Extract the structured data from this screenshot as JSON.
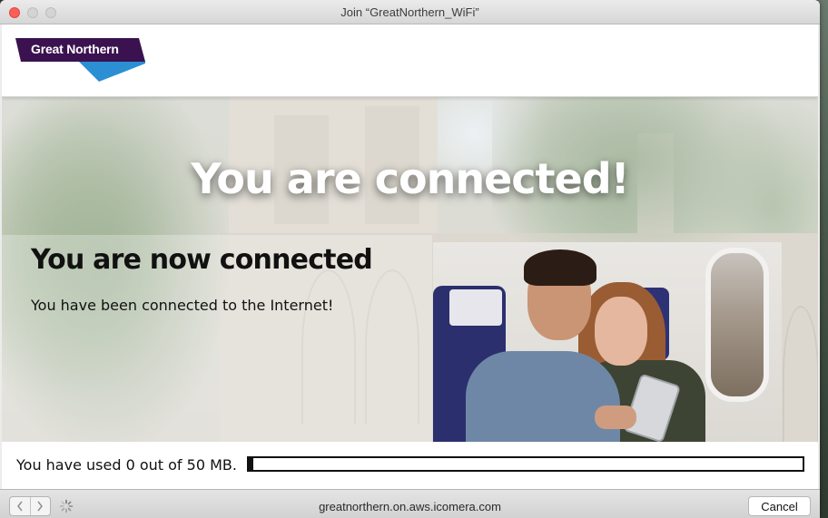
{
  "window": {
    "title": "Join “GreatNorthern_WiFi”"
  },
  "brand": {
    "logo_text": "Great Northern",
    "colors": {
      "purple": "#3b1250",
      "blue": "#2c8fd4"
    }
  },
  "hero": {
    "title": "You are connected!"
  },
  "panel": {
    "heading": "You are now connected",
    "text": "You have been connected to the Internet!"
  },
  "usage": {
    "text": "You have used 0 out of 50 MB.",
    "fraction_used": 0.0
  },
  "toolbar": {
    "back_icon": "chevron-left-icon",
    "forward_icon": "chevron-right-icon",
    "loading_icon": "spinner-icon",
    "url": "greatnorthern.on.aws.icomera.com",
    "cancel_label": "Cancel"
  }
}
